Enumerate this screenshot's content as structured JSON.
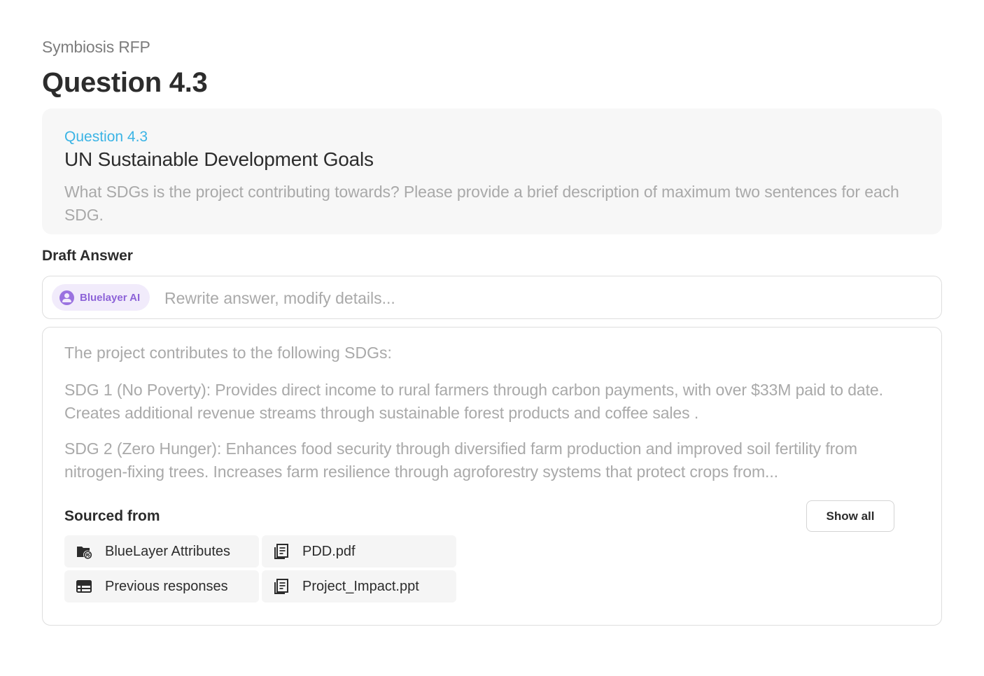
{
  "breadcrumb": "Symbiosis RFP",
  "page_title": "Question 4.3",
  "question": {
    "number": "Question 4.3",
    "title": "UN Sustainable Development Goals",
    "description": "What SDGs is the project contributing towards? Please provide a brief description of maximum two sentences for each SDG."
  },
  "draft": {
    "label": "Draft Answer",
    "ai_chip_label": "Bluelayer AI",
    "ai_chip_icon": "ai-assistant-icon",
    "input_placeholder": "Rewrite answer, modify details...",
    "input_value": ""
  },
  "answer": {
    "intro": "The project contributes to the following SDGs:",
    "paragraphs": [
      "SDG 1 (No Poverty): Provides direct income to rural farmers through carbon payments, with over $33M paid to date. Creates additional revenue streams through sustainable forest products and coffee sales .",
      "SDG 2 (Zero Hunger): Enhances food security through diversified farm production and improved soil fertility from nitrogen-fixing trees. Increases farm resilience through agroforestry systems that protect crops from..."
    ]
  },
  "sources": {
    "label": "Sourced from",
    "show_all_label": "Show all",
    "items": [
      {
        "label": "BlueLayer Attributes",
        "icon": "folder-link-icon"
      },
      {
        "label": "PDD.pdf",
        "icon": "document-icon"
      },
      {
        "label": "Previous responses",
        "icon": "table-icon"
      },
      {
        "label": "Project_Impact.ppt",
        "icon": "document-icon"
      }
    ]
  },
  "colors": {
    "accent_blue": "#3bb4e5",
    "ai_purple": "#8d63d8",
    "ai_chip_bg": "#f1ebfb",
    "muted_text": "#a9a9a9"
  }
}
